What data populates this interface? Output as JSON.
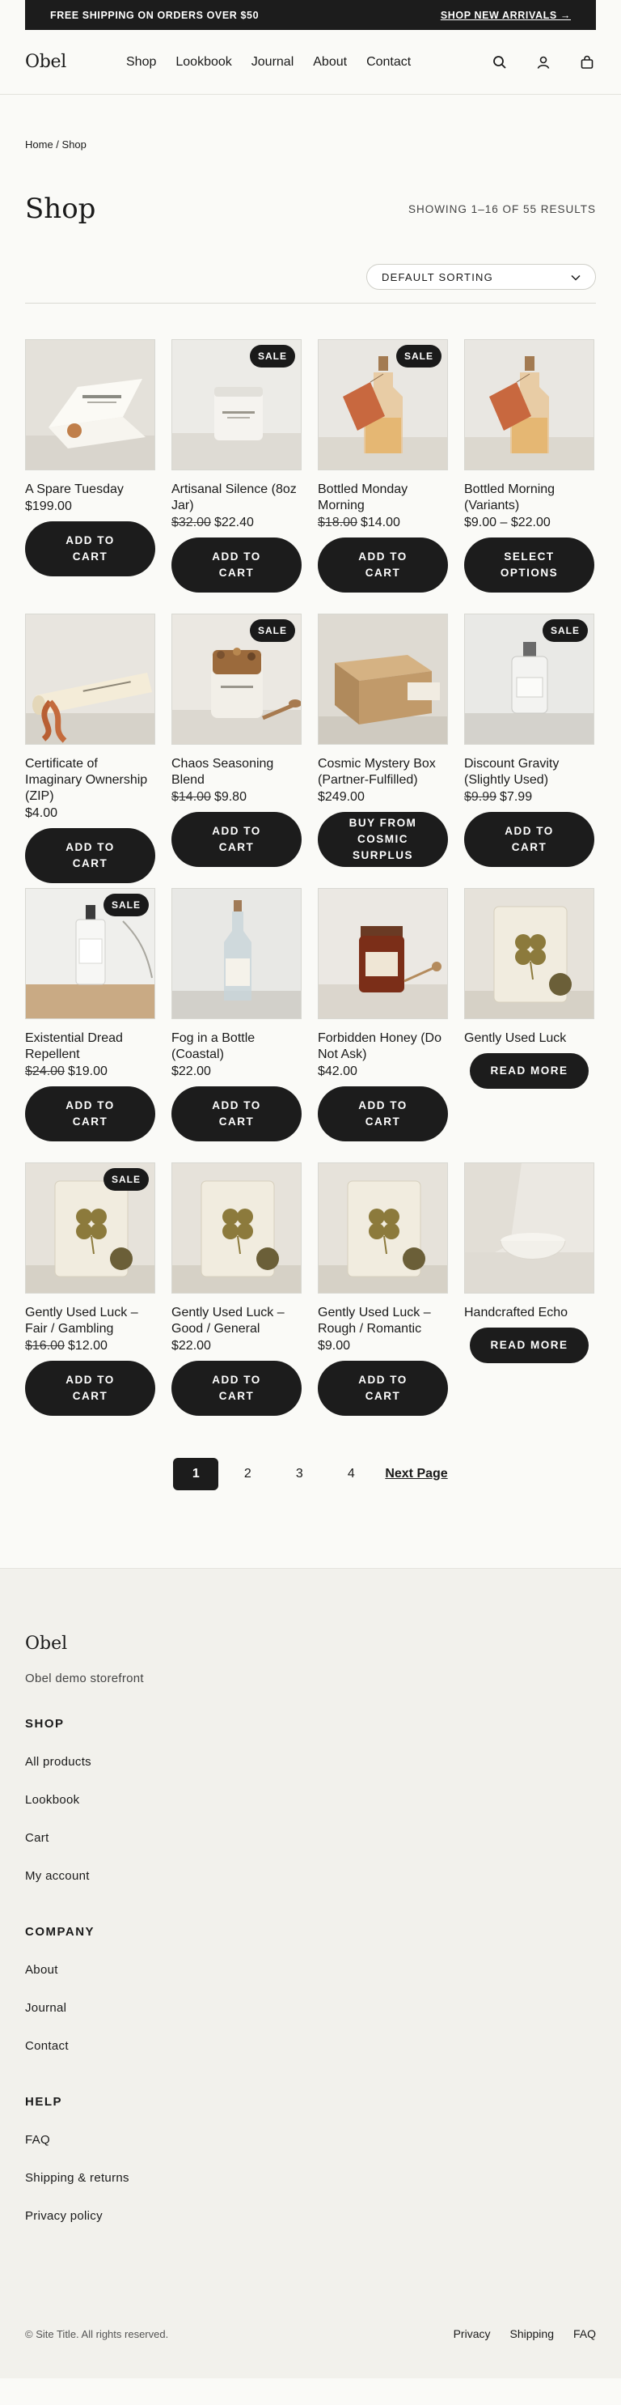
{
  "announcement": {
    "left": "FREE SHIPPING ON ORDERS OVER $50",
    "right": "SHOP NEW ARRIVALS →"
  },
  "header": {
    "logo": "Obel",
    "nav": [
      "Shop",
      "Lookbook",
      "Journal",
      "About",
      "Contact"
    ],
    "icons": [
      "search-icon",
      "account-icon",
      "cart-icon"
    ]
  },
  "breadcrumb": {
    "home": "Home",
    "separator": " / ",
    "current": "Shop"
  },
  "page_title": "Shop",
  "result_count": "SHOWING 1–16 OF 55 RESULTS",
  "sort": {
    "selected": "DEFAULT SORTING"
  },
  "products": [
    {
      "name": "A Spare Tuesday",
      "old_price": "",
      "price": "$199.00",
      "sale": false,
      "button": "ADD TO CART",
      "image": "card"
    },
    {
      "name": "Artisanal Silence (8oz Jar)",
      "old_price": "$32.00",
      "price": "$22.40",
      "sale": true,
      "button": "ADD TO CART",
      "image": "jar"
    },
    {
      "name": "Bottled Monday Morning",
      "old_price": "$18.00",
      "price": "$14.00",
      "sale": true,
      "button": "ADD TO CART",
      "image": "bottle-tag"
    },
    {
      "name": "Bottled Morning (Variants)",
      "old_price": "",
      "price": "$9.00 – $22.00",
      "sale": false,
      "button": "SELECT OPTIONS",
      "image": "bottle-tag"
    },
    {
      "name": "Certificate of Imaginary Ownership (ZIP)",
      "old_price": "",
      "price": "$4.00",
      "sale": false,
      "button": "ADD TO CART",
      "image": "scroll"
    },
    {
      "name": "Chaos Seasoning Blend",
      "old_price": "$14.00",
      "price": "$9.80",
      "sale": true,
      "button": "ADD TO CART",
      "image": "spice-jar"
    },
    {
      "name": "Cosmic Mystery Box (Partner-Fulfilled)",
      "old_price": "",
      "price": "$249.00",
      "sale": false,
      "button": "BUY FROM COSMIC SURPLUS",
      "image": "box"
    },
    {
      "name": "Discount Gravity (Slightly Used)",
      "old_price": "$9.99",
      "price": "$7.99",
      "sale": true,
      "button": "ADD TO CART",
      "image": "small-bottle"
    },
    {
      "name": "Existential Dread Repellent",
      "old_price": "$24.00",
      "price": "$19.00",
      "sale": true,
      "button": "ADD TO CART",
      "image": "spray"
    },
    {
      "name": "Fog in a Bottle (Coastal)",
      "old_price": "",
      "price": "$22.00",
      "sale": false,
      "button": "ADD TO CART",
      "image": "tall-bottle"
    },
    {
      "name": "Forbidden Honey (Do Not Ask)",
      "old_price": "",
      "price": "$42.00",
      "sale": false,
      "button": "ADD TO CART",
      "image": "honey"
    },
    {
      "name": "Gently Used Luck",
      "old_price": "",
      "price": "",
      "sale": false,
      "button": "READ MORE",
      "image": "clover"
    },
    {
      "name": "Gently Used Luck – Fair / Gambling",
      "old_price": "$16.00",
      "price": "$12.00",
      "sale": true,
      "button": "ADD TO CART",
      "image": "clover"
    },
    {
      "name": "Gently Used Luck – Good / General",
      "old_price": "",
      "price": "$22.00",
      "sale": false,
      "button": "ADD TO CART",
      "image": "clover"
    },
    {
      "name": "Gently Used Luck – Rough / Romantic",
      "old_price": "",
      "price": "$9.00",
      "sale": false,
      "button": "ADD TO CART",
      "image": "clover"
    },
    {
      "name": "Handcrafted Echo",
      "old_price": "",
      "price": "",
      "sale": false,
      "button": "READ MORE",
      "image": "bowl"
    }
  ],
  "sale_label": "SALE",
  "pagination": {
    "pages": [
      "1",
      "2",
      "3",
      "4"
    ],
    "current": "1",
    "next": "Next Page"
  },
  "footer": {
    "logo": "Obel",
    "tagline": "Obel demo storefront",
    "shop": {
      "heading": "SHOP",
      "links": [
        "All products",
        "Lookbook",
        "Cart",
        "My account"
      ]
    },
    "company": {
      "heading": "COMPANY",
      "links": [
        "About",
        "Journal",
        "Contact"
      ]
    },
    "help": {
      "heading": "HELP",
      "links": [
        "FAQ",
        "Shipping & returns",
        "Privacy policy"
      ]
    },
    "copyright": "© Site Title. All rights reserved.",
    "legal": [
      "Privacy",
      "Shipping",
      "FAQ"
    ]
  }
}
